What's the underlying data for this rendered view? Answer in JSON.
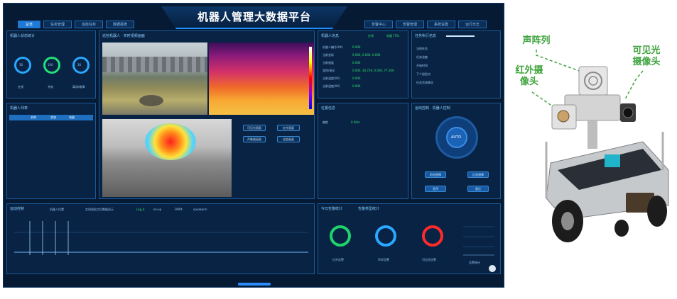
{
  "dashboard": {
    "title": "机器人管理大数据平台",
    "left_tabs": [
      "总览",
      "任务管理",
      "巡检任务",
      "数据报表"
    ],
    "right_tabs": [
      "告警中心",
      "告警管理",
      "系统设置",
      "运行日志"
    ],
    "active_tab": 0,
    "panels": {
      "robot_status": {
        "title": "机器人状态统计",
        "rings": [
          {
            "value": "30",
            "label": "在线",
            "color": "#2aa7ff"
          },
          {
            "value": "100",
            "label": "充电",
            "color": "#22e07a"
          },
          {
            "value": "30",
            "label": "离线/故障",
            "color": "#2aa7ff"
          }
        ]
      },
      "robot_list": {
        "title": "机器人列表",
        "columns": [
          "名称",
          "状态",
          "电量"
        ]
      },
      "video": {
        "title": "巡检机器人 · 实时视频画面",
        "buttons": [
          "可见光画面",
          "红外画面",
          "声像图画面",
          "全部画面"
        ]
      },
      "robot_info": {
        "title": "机器人信息",
        "badge1": "在线",
        "badge2": "电量 75%",
        "rows": [
          {
            "k": "机器人编号(XX)",
            "v": "0.000"
          },
          {
            "k": "当前坐标",
            "v": "0.000, 0.000, 0.000"
          },
          {
            "k": "当前速度",
            "v": "0.000"
          },
          {
            "k": "里程/电压",
            "v": "0.000, 10.729, 0.000, 77.200"
          },
          {
            "k": "当前温度(XX)",
            "v": "0.000"
          },
          {
            "k": "当前湿度(XX)",
            "v": "0.000"
          }
        ]
      },
      "task_info": {
        "title": "任务执行信息",
        "items": [
          "当前任务",
          "任务进度",
          "开始时间",
          "下个巡检点",
          "任务完成情况"
        ]
      },
      "pose": {
        "title": "位置信息",
        "key": "偏航",
        "value": "0.00m"
      },
      "control": {
        "title": "运动控制 · 机器人控制",
        "center": "AUTO",
        "buttons": [
          "前进避障",
          "后退避障",
          "急停",
          "复位"
        ]
      },
      "curve": {
        "title": "运动控制",
        "tags": [
          "机器人位置",
          "实时巡检点位数据显示",
          "Log_4",
          "ev-up",
          "FMPX",
          "speakerm"
        ]
      },
      "alarm_stats": {
        "title": "今日告警统计",
        "subtitle": "告警类型统计",
        "rings": [
          {
            "label": "红外告警",
            "color": "#1fd36a"
          },
          {
            "label": "声学告警",
            "color": "#2aa7ff"
          },
          {
            "label": "可见光告警",
            "color": "#ff2b2b"
          }
        ],
        "bar_label": "告警统计"
      }
    }
  },
  "robot": {
    "callouts": [
      {
        "text": "声阵列"
      },
      {
        "text": "可见光\n摄像头"
      },
      {
        "text": "红外摄\n像头"
      }
    ]
  }
}
